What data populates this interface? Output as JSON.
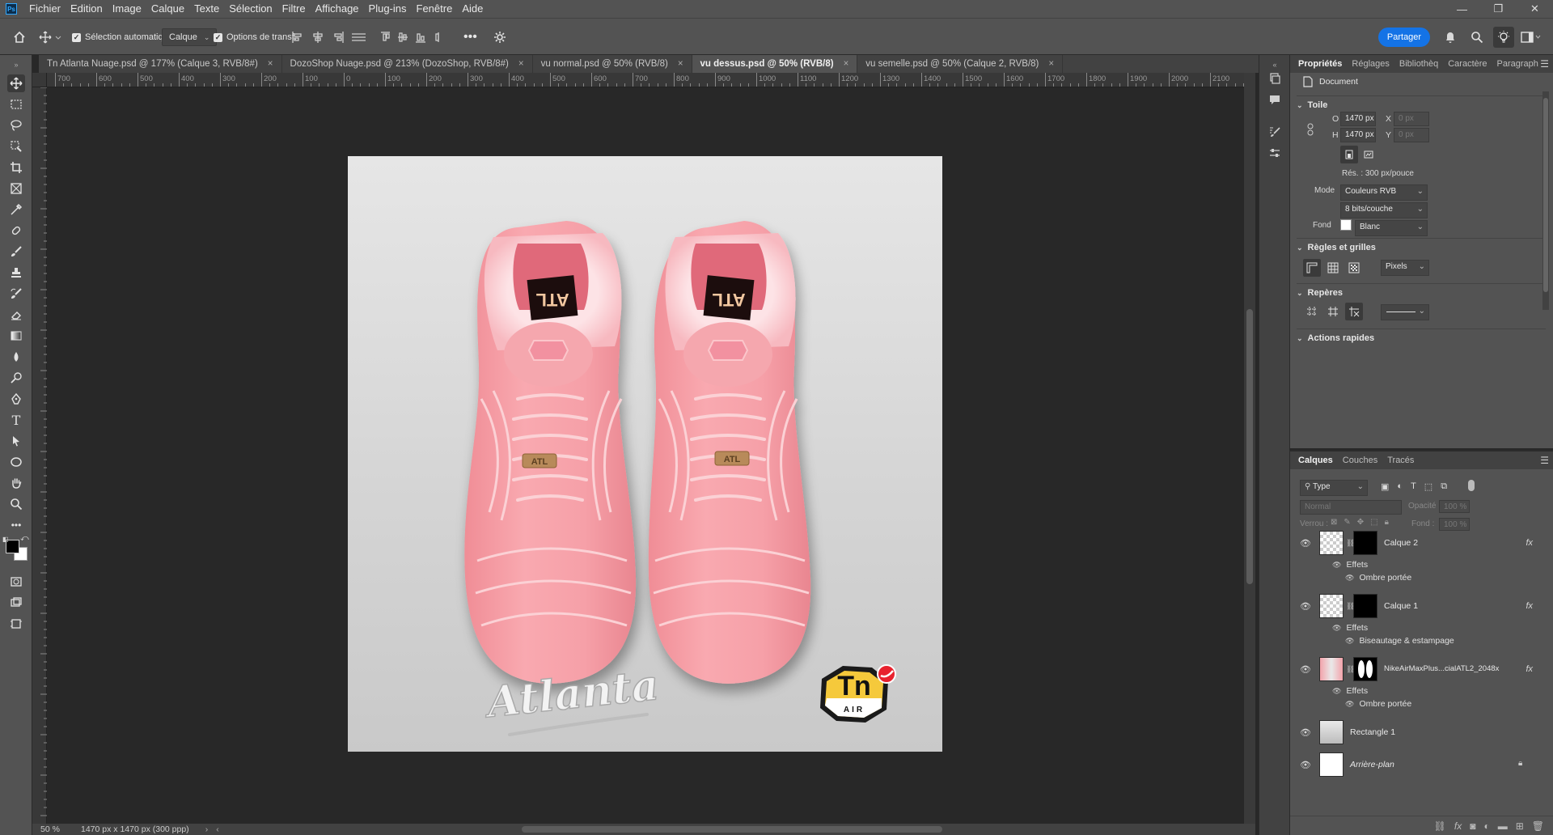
{
  "app": {
    "logo_text": "Ps",
    "menu": [
      "Fichier",
      "Edition",
      "Image",
      "Calque",
      "Texte",
      "Sélection",
      "Filtre",
      "Affichage",
      "Plug-ins",
      "Fenêtre",
      "Aide"
    ],
    "window_controls": [
      "—",
      "❐",
      "✕"
    ]
  },
  "options_bar": {
    "auto_select_label": "Sélection automatique :",
    "auto_select_value": "Calque",
    "transform_options_label": "Options de transf.",
    "share_label": "Partager"
  },
  "tabs": [
    {
      "label": "Tn Atlanta Nuage.psd @ 177% (Calque 3, RVB/8#)",
      "active": false
    },
    {
      "label": "DozoShop Nuage.psd @ 213% (DozoShop, RVB/8#)",
      "active": false
    },
    {
      "label": "vu normal.psd @ 50% (RVB/8)",
      "active": false
    },
    {
      "label": "vu dessus.psd @ 50% (RVB/8)",
      "active": true
    },
    {
      "label": "vu semelle.psd @ 50% (Calque 2, RVB/8)",
      "active": false
    }
  ],
  "rulers": {
    "horizontal_labels": [
      "700",
      "600",
      "500",
      "400",
      "300",
      "200",
      "100",
      "0",
      "100",
      "200",
      "300",
      "400",
      "500",
      "600",
      "700",
      "800",
      "900",
      "1000",
      "1100",
      "1200",
      "1300",
      "1400",
      "1500",
      "1600",
      "1700",
      "1800",
      "1900",
      "2000",
      "2100"
    ]
  },
  "status_bar": {
    "zoom": "50 %",
    "doc_info": "1470 px x 1470 px (300 ppp)"
  },
  "document_art": {
    "logo_script_text": "Atlanta",
    "badge_text_big": "Tn",
    "badge_text_small": "AIR",
    "tongue_label": "ATL",
    "plaque_label": "ATL",
    "shoe_color": "#f7a2aa",
    "shoe_shadow_color": "#e77f89"
  },
  "properties": {
    "tabs": [
      "Propriétés",
      "Réglages",
      "Bibliothèq",
      "Caractère",
      "Paragraph"
    ],
    "document_label": "Document",
    "canvas_section": "Toile",
    "width_label": "O",
    "width_value": "1470 px",
    "height_label": "H",
    "height_value": "1470 px",
    "x_label": "X",
    "x_value": "0 px",
    "y_label": "Y",
    "y_value": "0 px",
    "resolution": "Rés. : 300 px/pouce",
    "mode_label": "Mode",
    "mode_value": "Couleurs RVB",
    "depth_value": "8 bits/couche",
    "background_label": "Fond",
    "background_value": "Blanc",
    "rulers_section": "Règles et grilles",
    "units_value": "Pixels",
    "guides_section": "Repères",
    "quick_actions_section": "Actions rapides"
  },
  "layers_panel": {
    "tabs": [
      "Calques",
      "Couches",
      "Tracés"
    ],
    "filter_value": "Type",
    "blend_mode": "Normal",
    "opacity_label": "Opacité :",
    "opacity_value": "100 %",
    "lock_label": "Verrou :",
    "fill_label": "Fond :",
    "fill_value": "100 %",
    "layers": [
      {
        "name": "Calque 2",
        "effects_label": "Effets",
        "effect": "Ombre portée"
      },
      {
        "name": "Calque 1",
        "effects_label": "Effets",
        "effect": "Biseautage & estampage"
      },
      {
        "name": "NikeAirMaxPlus...cialATL2_2048x",
        "effects_label": "Effets",
        "effect": "Ombre portée"
      },
      {
        "name": "Rectangle 1"
      },
      {
        "name": "Arrière-plan"
      }
    ],
    "fx_label": "fx"
  }
}
